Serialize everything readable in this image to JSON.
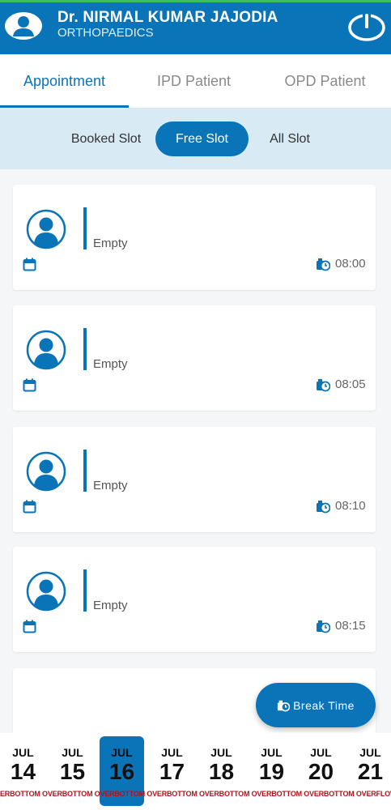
{
  "header": {
    "doctor_name": "Dr. NIRMAL KUMAR JAJODIA",
    "department": "ORTHOPAEDICS",
    "color": "#0a74b8"
  },
  "tabs": [
    {
      "label": "Appointment",
      "active": true
    },
    {
      "label": "IPD Patient",
      "active": false
    },
    {
      "label": "OPD Patient",
      "active": false
    }
  ],
  "slot_filter": [
    {
      "label": "Booked Slot",
      "active": false
    },
    {
      "label": "Free Slot",
      "active": true
    },
    {
      "label": "All Slot",
      "active": false
    }
  ],
  "slots": [
    {
      "status": "Empty",
      "time": "08:00"
    },
    {
      "status": "Empty",
      "time": "08:05"
    },
    {
      "status": "Empty",
      "time": "08:10"
    },
    {
      "status": "Empty",
      "time": "08:15"
    }
  ],
  "fab": {
    "label": "Break Time"
  },
  "dates": [
    {
      "month": "JUL",
      "day": "14",
      "active": false
    },
    {
      "month": "JUL",
      "day": "15",
      "active": false
    },
    {
      "month": "JUL",
      "day": "16",
      "active": true
    },
    {
      "month": "JUL",
      "day": "17",
      "active": false
    },
    {
      "month": "JUL",
      "day": "18",
      "active": false
    },
    {
      "month": "JUL",
      "day": "19",
      "active": false
    },
    {
      "month": "JUL",
      "day": "20",
      "active": false
    },
    {
      "month": "JUL",
      "day": "21",
      "active": false
    }
  ],
  "overflow_text": "ERBOTTOM OVERBOTTOM OVERBOTTOM OVERBOTTOM OVERBOTTOM OVERBOTTOM OVERBOTTOM OVERFLOWED B",
  "icons": {
    "avatar": "user-avatar-icon",
    "power": "power-icon",
    "calendar": "calendar-icon",
    "clock": "clock-icon"
  }
}
